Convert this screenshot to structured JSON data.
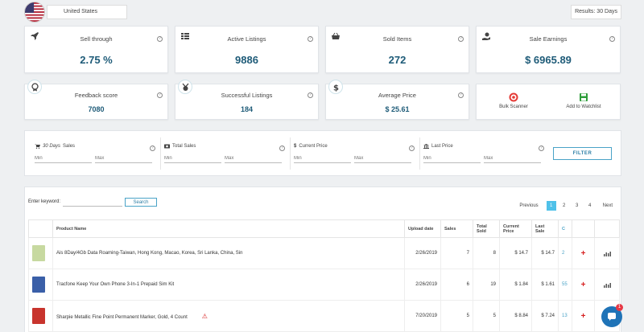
{
  "header": {
    "country": "United States",
    "results": "Results: 30 Days"
  },
  "stats": {
    "sell_through": {
      "title": "Sell through",
      "value": "2.75 %"
    },
    "active_listings": {
      "title": "Active Listings",
      "value": "9886"
    },
    "sold_items": {
      "title": "Sold Items",
      "value": "272"
    },
    "sale_earnings": {
      "title": "Sale Earnings",
      "value": "$ 6965.89"
    },
    "feedback_score": {
      "title": "Feedback score",
      "value": "7080"
    },
    "successful_listings": {
      "title": "Successful Listings",
      "value": "184"
    },
    "average_price": {
      "title": "Average Price",
      "value": "$ 25.61"
    }
  },
  "actions": {
    "bulk_scanner": "Bulk Scanner",
    "add_watchlist": "Add to Watchlist"
  },
  "filters": {
    "sales_30": {
      "label_italic": "30 Days",
      "label": "Sales"
    },
    "total_sales": {
      "label": "Total Sales"
    },
    "current_price": {
      "label": "Current Price"
    },
    "last_price": {
      "label": "Last Price"
    },
    "min_placeholder": "Min",
    "max_placeholder": "Max",
    "button": "FILTER"
  },
  "table_controls": {
    "keyword_label": "Enter keyword:",
    "search_button": "Search",
    "pager": {
      "previous": "Previous",
      "pages": [
        "1",
        "2",
        "3",
        "4"
      ],
      "next": "Next",
      "active": "1"
    }
  },
  "table": {
    "headers": {
      "product_name": "Product Name",
      "upload_date": "Upload date",
      "sales": "Sales",
      "total_sold": "Total Sold",
      "current_price": "Current Price",
      "last_price": "Last Sale",
      "c": "C"
    },
    "rows": [
      {
        "name": "Ais 8Day/4Gb Data Roaming-Taiwan, Hong Kong, Macao, Korea, Sri Lanka, China, Sin",
        "upload_date": "2/26/2019",
        "sales": "7",
        "total_sold": "8",
        "current_price": "$ 14.7",
        "last_price": "$ 14.7",
        "c": "2",
        "thumb_color": "#c7d9a0"
      },
      {
        "name": "Tracfone Keep Your Own Phone 3-In-1 Prepaid Sim Kit",
        "upload_date": "2/26/2019",
        "sales": "6",
        "total_sold": "19",
        "current_price": "$ 1.84",
        "last_price": "$ 1.61",
        "c": "55",
        "thumb_color": "#3a5fa8"
      },
      {
        "name": "Sharpie Metallic Fine Point Permanent Marker, Gold, 4 Count",
        "upload_date": "7/20/2019",
        "sales": "5",
        "total_sold": "5",
        "current_price": "$ 8.84",
        "last_price": "$ 7.24",
        "c": "13",
        "thumb_color": "#c8342d",
        "warning": true
      }
    ]
  },
  "chat": {
    "badge": "1"
  }
}
